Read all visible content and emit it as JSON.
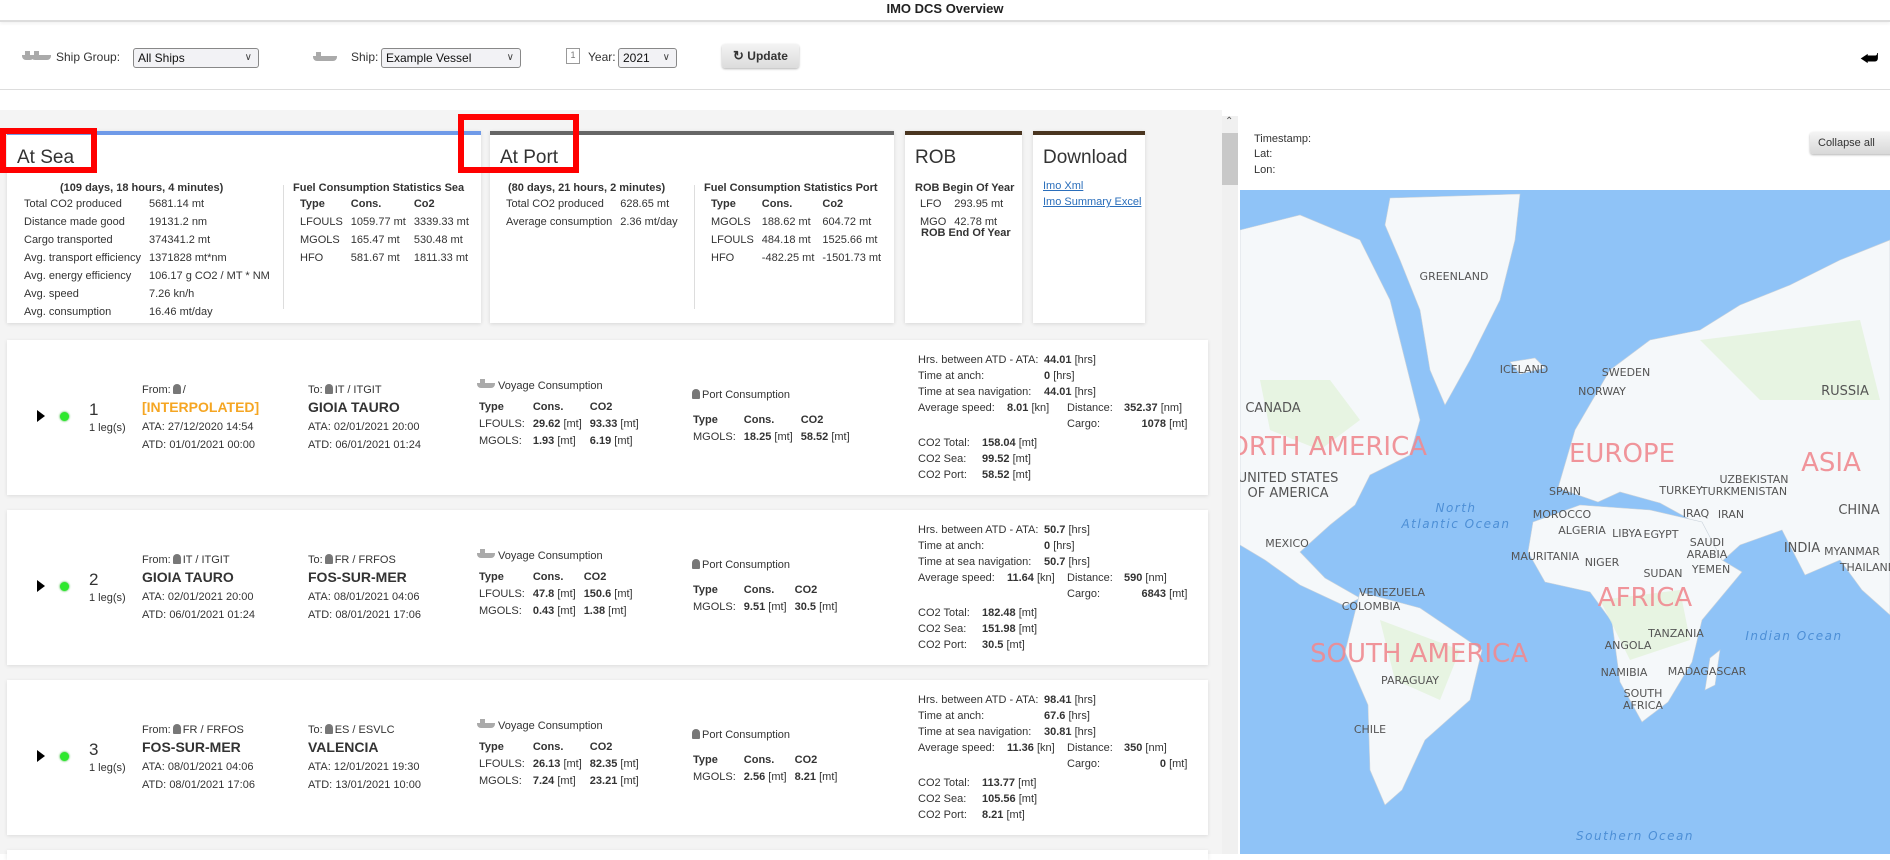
{
  "window": {
    "title": "IMO DCS Overview"
  },
  "toolbar": {
    "ship_group_label": "Ship Group:",
    "ship_group_value": "All Ships",
    "ship_label": "Ship:",
    "ship_value": "Example Vessel",
    "year_label": "Year:",
    "year_value": "2021",
    "update_label": "Update",
    "calendar_day": "1"
  },
  "at_sea": {
    "title": "At Sea",
    "duration": "(109 days, 18 hours, 4 minutes)",
    "stats": [
      {
        "label": "Total CO2 produced",
        "value": "5681.14 mt"
      },
      {
        "label": "Distance made good",
        "value": "19131.2 nm"
      },
      {
        "label": "Cargo transported",
        "value": "374341.2 mt"
      },
      {
        "label": "Avg. transport efficiency",
        "value": "1371828 mt*nm"
      },
      {
        "label": "Avg. energy efficiency",
        "value": "106.17 g CO2 / MT * NM"
      },
      {
        "label": "Avg. speed",
        "value": "7.26 kn/h"
      },
      {
        "label": "Avg. consumption",
        "value": "16.46 mt/day"
      }
    ],
    "fuel_title": "Fuel Consumption Statistics Sea",
    "fuel_headers": [
      "Type",
      "Cons.",
      "Co2"
    ],
    "fuel_rows": [
      [
        "LFOULS",
        "1059.77 mt",
        "3339.33 mt"
      ],
      [
        "MGOLS",
        "165.47 mt",
        "530.48 mt"
      ],
      [
        "HFO",
        "581.67 mt",
        "1811.33 mt"
      ]
    ]
  },
  "at_port": {
    "title": "At Port",
    "duration": "(80 days, 21 hours, 2 minutes)",
    "stats": [
      {
        "label": "Total CO2 produced",
        "value": "628.65 mt"
      },
      {
        "label": "Average consumption",
        "value": "2.36 mt/day"
      }
    ],
    "fuel_title": "Fuel Consumption Statistics Port",
    "fuel_headers": [
      "Type",
      "Cons.",
      "Co2"
    ],
    "fuel_rows": [
      [
        "MGOLS",
        "188.62 mt",
        "604.72 mt"
      ],
      [
        "LFOULS",
        "484.18 mt",
        "1525.66 mt"
      ],
      [
        "HFO",
        "-482.25 mt",
        "-1501.73 mt"
      ]
    ]
  },
  "rob": {
    "title": "ROB",
    "begin_label": "ROB Begin Of Year",
    "begin_rows": [
      [
        "LFO",
        "293.95 mt"
      ],
      [
        "MGO",
        "42.78 mt"
      ]
    ],
    "end_label": "ROB End Of Year"
  },
  "download": {
    "title": "Download",
    "links": [
      "Imo Xml",
      "Imo Summary Excel"
    ]
  },
  "voyage_labels": {
    "from": "From:",
    "to": "To:",
    "ata": "ATA:",
    "atd": "ATD:",
    "voyage_consumption": "Voyage Consumption",
    "port_consumption": "Port Consumption",
    "type": "Type",
    "cons": "Cons.",
    "co2": "CO2",
    "unit_mt": "[mt]",
    "hrs_between": "Hrs. between ATD - ATA:",
    "time_anch": "Time at anch:",
    "time_sea": "Time at sea navigation:",
    "avg_speed": "Average speed:",
    "distance": "Distance:",
    "cargo": "Cargo:",
    "co2_total": "CO2 Total:",
    "co2_sea": "CO2 Sea:",
    "co2_port": "CO2 Port:",
    "unit_hrs": "[hrs]",
    "unit_kn": "[kn]",
    "unit_nm": "[nm]"
  },
  "voyages": [
    {
      "num": "1",
      "legs": "1 leg(s)",
      "status_color": "#2ee82e",
      "from_code": "/",
      "from_name": "[INTERPOLATED]",
      "from_interpolated": true,
      "from_ata": "27/12/2020 14:54",
      "from_atd": "01/01/2021 00:00",
      "to_code": "IT / ITGIT",
      "to_name": "GIOIA TAURO",
      "to_ata": "02/01/2021 20:00",
      "to_atd": "06/01/2021 01:24",
      "voyage_rows": [
        [
          "LFOULS:",
          "29.62",
          "93.33"
        ],
        [
          "MGOLS:",
          "1.93",
          "6.19"
        ]
      ],
      "port_rows": [
        [
          "MGOLS:",
          "18.25",
          "58.52"
        ]
      ],
      "hrs_between": "44.01",
      "time_anch": "0",
      "time_sea": "44.01",
      "avg_speed": "8.01",
      "distance": "352.37",
      "cargo": "1078",
      "co2_total": "158.04",
      "co2_sea": "99.52",
      "co2_port": "58.52"
    },
    {
      "num": "2",
      "legs": "1 leg(s)",
      "status_color": "#2ee82e",
      "from_code": "IT / ITGIT",
      "from_name": "GIOIA TAURO",
      "from_interpolated": false,
      "from_ata": "02/01/2021 20:00",
      "from_atd": "06/01/2021 01:24",
      "to_code": "FR / FRFOS",
      "to_name": "FOS-SUR-MER",
      "to_ata": "08/01/2021 04:06",
      "to_atd": "08/01/2021 17:06",
      "voyage_rows": [
        [
          "LFOULS:",
          "47.8",
          "150.6"
        ],
        [
          "MGOLS:",
          "0.43",
          "1.38"
        ]
      ],
      "port_rows": [
        [
          "MGOLS:",
          "9.51",
          "30.5"
        ]
      ],
      "hrs_between": "50.7",
      "time_anch": "0",
      "time_sea": "50.7",
      "avg_speed": "11.64",
      "distance": "590",
      "cargo": "6843",
      "co2_total": "182.48",
      "co2_sea": "151.98",
      "co2_port": "30.5"
    },
    {
      "num": "3",
      "legs": "1 leg(s)",
      "status_color": "#2ee82e",
      "from_code": "FR / FRFOS",
      "from_name": "FOS-SUR-MER",
      "from_interpolated": false,
      "from_ata": "08/01/2021 04:06",
      "from_atd": "08/01/2021 17:06",
      "to_code": "ES / ESVLC",
      "to_name": "VALENCIA",
      "to_ata": "12/01/2021 19:30",
      "to_atd": "13/01/2021 10:00",
      "voyage_rows": [
        [
          "LFOULS:",
          "26.13",
          "82.35"
        ],
        [
          "MGOLS:",
          "7.24",
          "23.21"
        ]
      ],
      "port_rows": [
        [
          "MGOLS:",
          "2.56",
          "8.21"
        ]
      ],
      "hrs_between": "98.41",
      "time_anch": "67.6",
      "time_sea": "30.81",
      "avg_speed": "11.36",
      "distance": "350",
      "cargo": "0",
      "co2_total": "113.77",
      "co2_sea": "105.56",
      "co2_port": "8.21"
    }
  ],
  "map_panel": {
    "timestamp_label": "Timestamp:",
    "lat_label": "Lat:",
    "lon_label": "Lon:",
    "collapse_label": "Collapse all",
    "labels": {
      "greenland": "GREENLAND",
      "iceland": "ICELAND",
      "sweden": "SWEDEN",
      "norway": "NORWAY",
      "russia": "RUSSIA",
      "canada": "CANADA",
      "north_america": "NORTH AMERICA",
      "europe": "EUROPE",
      "asia": "ASIA",
      "usa1": "UNITED STATES",
      "usa2": "OF AMERICA",
      "spain": "SPAIN",
      "uzbekistan": "UZBEKISTAN",
      "turkey": "TURKEY",
      "turkmenistan": "TURKMENISTAN",
      "north_atlantic1": "North",
      "north_atlantic2": "Atlantic Ocean",
      "morocco": "MOROCCO",
      "iraq": "IRAQ",
      "iran": "IRAN",
      "china": "CHINA",
      "algeria": "ALGERIA",
      "libya": "LIBYA",
      "egypt": "EGYPT",
      "mexico": "MEXICO",
      "saudi1": "SAUDI",
      "saudi2": "ARABIA",
      "india": "INDIA",
      "myanmar": "MYANMAR",
      "mauritania": "MAURITANIA",
      "niger": "NIGER",
      "thailand": "THAILAND",
      "yemen": "YEMEN",
      "sudan": "SUDAN",
      "africa": "AFRICA",
      "venezuela": "VENEZUELA",
      "colombia": "COLOMBIA",
      "tanzania": "TANZANIA",
      "indian_ocean": "Indian Ocean",
      "angola": "ANGOLA",
      "south_america": "SOUTH AMERICA",
      "namibia": "NAMIBIA",
      "madagascar": "MADAGASCAR",
      "paraguay": "PARAGUAY",
      "south_africa1": "SOUTH",
      "south_africa2": "AFRICA",
      "chile": "CHILE",
      "southern_ocean": "Southern Ocean"
    }
  },
  "colors": {
    "at_sea_accent": "#6f9ae8",
    "at_port_accent": "#666666",
    "rob_accent": "#4a3520",
    "download_accent": "#4a3520",
    "highlight": "#ff0000",
    "interpolated": "#f5a623",
    "link": "#2a6ebb",
    "ocean": "#8fc3f7"
  }
}
